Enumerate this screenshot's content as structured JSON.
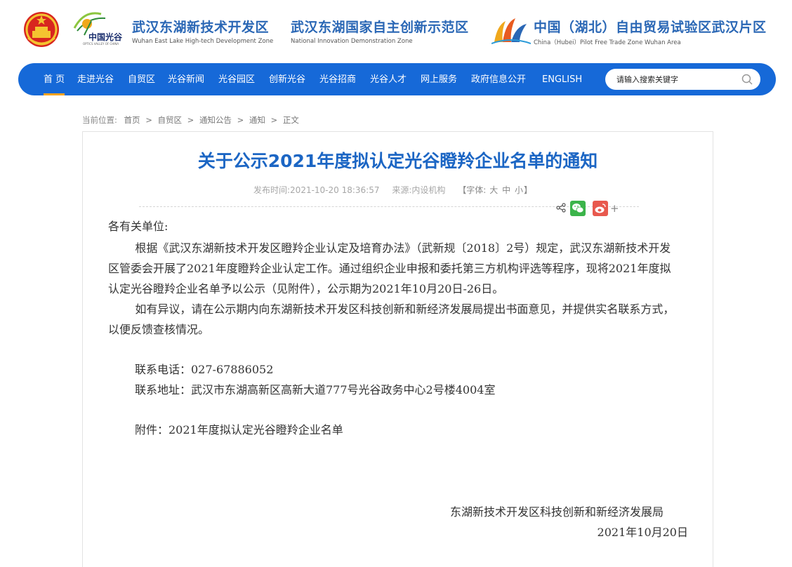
{
  "header": {
    "ovg_logo_text": "中国光谷",
    "ovg_logo_sub": "OPTICS VALLEY OF CHINA",
    "zones": [
      {
        "zh": "武汉东湖新技术开发区",
        "en": "Wuhan East Lake High-tech Development Zone"
      },
      {
        "zh": "武汉东湖国家自主创新示范区",
        "en": "National Innovation Demonstration Zone"
      },
      {
        "zh": "中国（湖北）自由贸易试验区武汉片区",
        "en": "China（Hubei）Pilot Free Trade Zone Wuhan Area"
      }
    ]
  },
  "nav": {
    "items": [
      "首 页",
      "走进光谷",
      "自贸区",
      "光谷新闻",
      "光谷园区",
      "创新光谷",
      "光谷招商",
      "光谷人才",
      "网上服务",
      "政府信息公开",
      "ENGLISH"
    ],
    "active_index": 0,
    "search_placeholder": "请输入搜索关键字"
  },
  "breadcrumb": {
    "prefix": "当前位置:",
    "items": [
      "首页",
      "自贸区",
      "通知公告",
      "通知"
    ],
    "separator": ">",
    "current": "正文"
  },
  "article": {
    "title": "关于公示2021年度拟认定光谷瞪羚企业名单的通知",
    "meta": {
      "publish_label": "发布时间:",
      "publish_time": "2021-10-20 18:36:57",
      "source_label": "来源:",
      "source": "内设机构",
      "font_open": "【字体:",
      "font_sizes": [
        "大",
        "中",
        "小"
      ],
      "font_close": "】"
    },
    "share": {
      "plus": "+"
    },
    "salutation": "各有关单位:",
    "paragraphs": [
      "根据《武汉东湖新技术开发区瞪羚企业认定及培育办法》（武新规〔2018〕2号）规定，武汉东湖新技术开发区管委会开展了2021年度瞪羚企业认定工作。通过组织企业申报和委托第三方机构评选等程序，现将2021年度拟认定光谷瞪羚企业名单予以公示（见附件），公示期为2021年10月20日-26日。",
      "如有异议，请在公示期内向东湖新技术开发区科技创新和新经济发展局提出书面意见，并提供实名联系方式，以便反馈查核情况。"
    ],
    "contact_phone": "联系电话：027-67886052",
    "contact_address": "联系地址：武汉市东湖高新区高新大道777号光谷政务中心2号楼4004室",
    "attachment": "附件：2021年度拟认定光谷瞪羚企业名单",
    "signature_org": "东湖新技术开发区科技创新和新经济发展局",
    "signature_date": "2021年10月20日"
  },
  "colors": {
    "nav_bg": "#1669d8",
    "title": "#1c66c4",
    "active_underline": "#f5a31a",
    "wechat": "#3bb44a",
    "weibo": "#e8594e"
  }
}
